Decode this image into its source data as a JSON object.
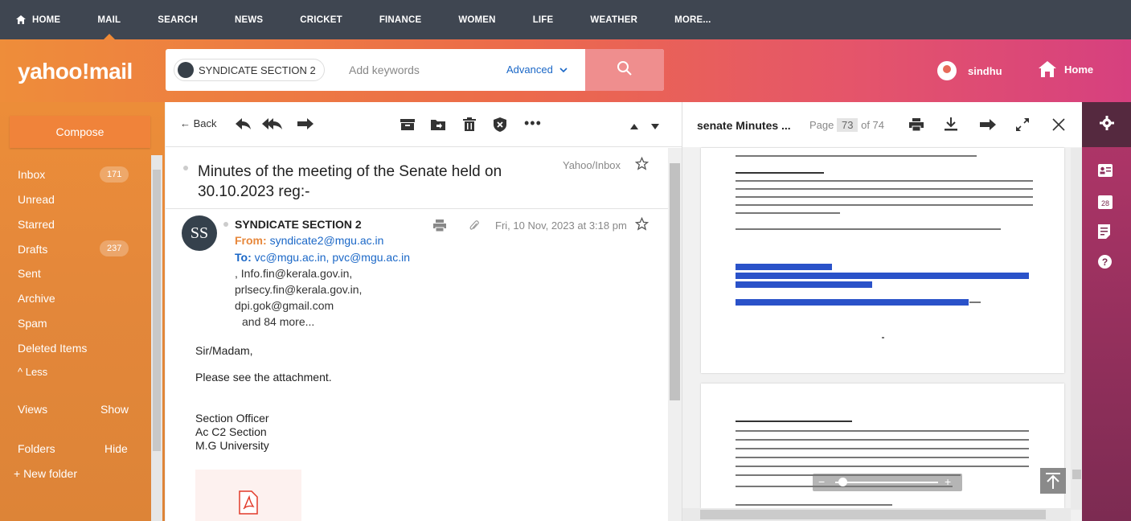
{
  "topnav": {
    "items": [
      {
        "label": "HOME"
      },
      {
        "label": "MAIL"
      },
      {
        "label": "SEARCH"
      },
      {
        "label": "NEWS"
      },
      {
        "label": "CRICKET"
      },
      {
        "label": "FINANCE"
      },
      {
        "label": "WOMEN"
      },
      {
        "label": "LIFE"
      },
      {
        "label": "WEATHER"
      },
      {
        "label": "MORE..."
      }
    ]
  },
  "header": {
    "logo": "yahoo!mail",
    "search": {
      "chip_label": "SYNDICATE SECTION 2",
      "placeholder": "Add keywords",
      "advanced_label": "Advanced"
    },
    "user_name": "sindhu",
    "home_label": "Home"
  },
  "sidebar": {
    "compose_label": "Compose",
    "folders": [
      {
        "label": "Inbox",
        "count": "171"
      },
      {
        "label": "Unread"
      },
      {
        "label": "Starred"
      },
      {
        "label": "Drafts",
        "count": "237"
      },
      {
        "label": "Sent"
      },
      {
        "label": "Archive"
      },
      {
        "label": "Spam"
      },
      {
        "label": "Deleted Items"
      },
      {
        "label": "^ Less"
      }
    ],
    "views_label": "Views",
    "views_action": "Show",
    "folders_label": "Folders",
    "folders_action": "Hide",
    "new_folder_label": "+ New folder"
  },
  "message": {
    "toolbar": {
      "back_label": "Back"
    },
    "subject": "Minutes of the meeting of the Senate held on 30.10.2023 reg:-",
    "source_label": "Yahoo/Inbox",
    "sender_initials": "SS",
    "sender_name": "SYNDICATE SECTION 2",
    "from_label": "From:",
    "from_email": "syndicate2@mgu.ac.in",
    "to_label": "To:",
    "to_line1": "vc@mgu.ac.in,  pvc@mgu.ac.in",
    "to_line2": ",  Info.fin@kerala.gov.in,",
    "to_line3": "prlsecy.fin@kerala.gov.in,",
    "to_line4": "dpi.gok@gmail.com",
    "more_recipients": "and 84 more...",
    "date": "Fri, 10 Nov, 2023 at 3:18 pm",
    "body": {
      "greeting": "Sir/Madam,",
      "text": "Please see the attachment.",
      "sig1": "Section Officer",
      "sig2": "Ac C2 Section",
      "sig3": "M.G University"
    }
  },
  "preview": {
    "title": "senate Minutes ...",
    "page_label": "Page",
    "page_current": "73",
    "page_total": "of 74"
  },
  "colors": {
    "nav_bg": "#3f4651",
    "accent_orange": "#f0833a",
    "link_blue": "#1a67c7",
    "highlight": "#2a52c9"
  }
}
